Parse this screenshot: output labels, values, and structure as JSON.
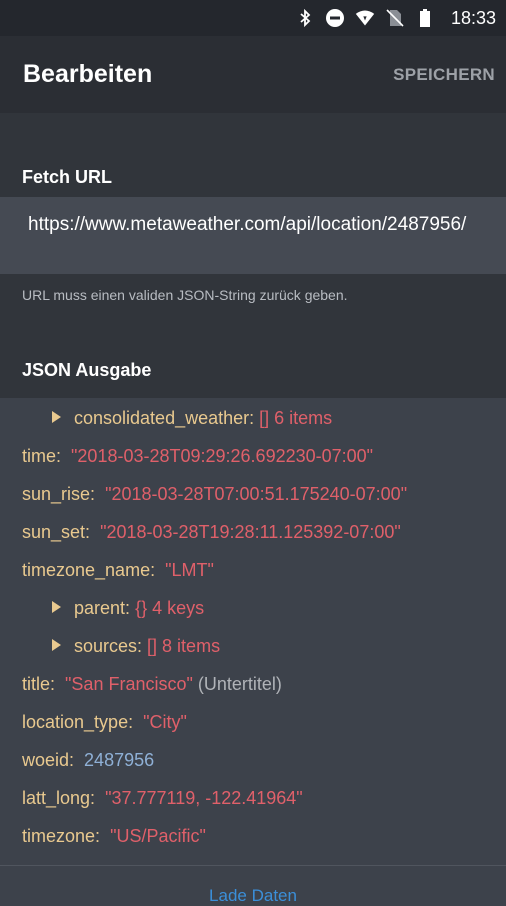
{
  "status_bar": {
    "time": "18:33",
    "icons": [
      "bluetooth-icon",
      "do-not-disturb-icon",
      "wifi-icon",
      "no-sim-icon",
      "battery-icon"
    ]
  },
  "appbar": {
    "title": "Bearbeiten",
    "save_label": "SPEICHERN"
  },
  "fetch": {
    "title": "Fetch URL",
    "url": "https://www.metaweather.com/api/location/2487956/",
    "hint": "URL muss einen validen JSON-String zurück geben."
  },
  "json_section": {
    "title": "JSON Ausgabe"
  },
  "json": {
    "consolidated_weather": {
      "key": "consolidated_weather:",
      "meta": "[] 6 items"
    },
    "time": {
      "key": "time:",
      "value": "\"2018-03-28T09:29:26.692230-07:00\""
    },
    "sun_rise": {
      "key": "sun_rise:",
      "value": "\"2018-03-28T07:00:51.175240-07:00\""
    },
    "sun_set": {
      "key": "sun_set:",
      "value": "\"2018-03-28T19:28:11.125392-07:00\""
    },
    "timezone_name": {
      "key": "timezone_name:",
      "value": "\"LMT\""
    },
    "parent": {
      "key": "parent:",
      "meta": "{} 4 keys"
    },
    "sources": {
      "key": "sources:",
      "meta": "[] 8 items"
    },
    "title": {
      "key": "title:",
      "value": "\"San Francisco\"",
      "note": "(Untertitel)"
    },
    "location_type": {
      "key": "location_type:",
      "value": "\"City\""
    },
    "woeid": {
      "key": "woeid:",
      "value": "2487956"
    },
    "latt_long": {
      "key": "latt_long:",
      "value": "\"37.777119, -122.41964\""
    },
    "timezone": {
      "key": "timezone:",
      "value": "\"US/Pacific\""
    }
  },
  "footer": {
    "load_label": "Lade Daten"
  },
  "colors": {
    "background": "#3d424b",
    "key": "#e9c98f",
    "string": "#e0606a",
    "number": "#8fb0d6",
    "accent": "#3b8fd9"
  }
}
